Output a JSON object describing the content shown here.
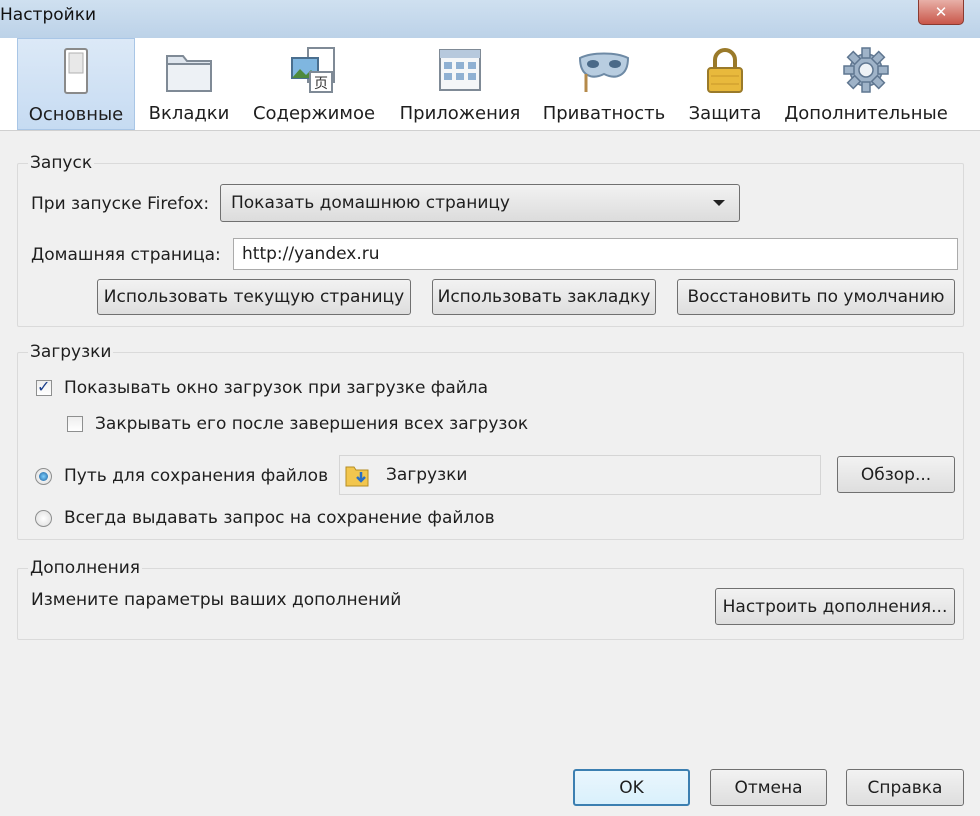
{
  "window": {
    "title": "Настройки",
    "close_glyph": "✕"
  },
  "tabs": [
    {
      "label": "Основные",
      "icon": "switch-icon",
      "active": true
    },
    {
      "label": "Вкладки",
      "icon": "folder-tabs-icon",
      "active": false
    },
    {
      "label": "Содержимое",
      "icon": "content-icon",
      "active": false
    },
    {
      "label": "Приложения",
      "icon": "applications-icon",
      "active": false
    },
    {
      "label": "Приватность",
      "icon": "mask-icon",
      "active": false
    },
    {
      "label": "Защита",
      "icon": "padlock-icon",
      "active": false
    },
    {
      "label": "Дополнительные",
      "icon": "gear-icon",
      "active": false
    }
  ],
  "startup": {
    "title": "Запуск",
    "when_start_label": "При запуске Firefox:",
    "when_start_value": "Показать домашнюю страницу",
    "homepage_label": "Домашняя страница:",
    "homepage_value": "http://yandex.ru",
    "use_current_label": "Использовать текущую страницу",
    "use_bookmark_label": "Использовать закладку",
    "restore_default_label": "Восстановить по умолчанию"
  },
  "downloads": {
    "title": "Загрузки",
    "show_window_label": "Показывать окно загрузок при загрузке файла",
    "show_window_checked": true,
    "close_after_label": "Закрывать его после завершения всех загрузок",
    "close_after_checked": false,
    "save_path_label": "Путь для сохранения файлов",
    "save_path_selected": true,
    "save_path_value": "Загрузки",
    "browse_label": "Обзор...",
    "always_ask_label": "Всегда выдавать запрос на сохранение файлов",
    "always_ask_selected": false
  },
  "addons": {
    "title": "Дополнения",
    "description": "Измените параметры ваших дополнений",
    "manage_label": "Настроить дополнения..."
  },
  "footer": {
    "ok_label": "OK",
    "cancel_label": "Отмена",
    "help_label": "Справка"
  },
  "colors": {
    "accent": "#3c7fb1",
    "active_tab": "#c6dbf2",
    "background": "#f0f0f0"
  }
}
